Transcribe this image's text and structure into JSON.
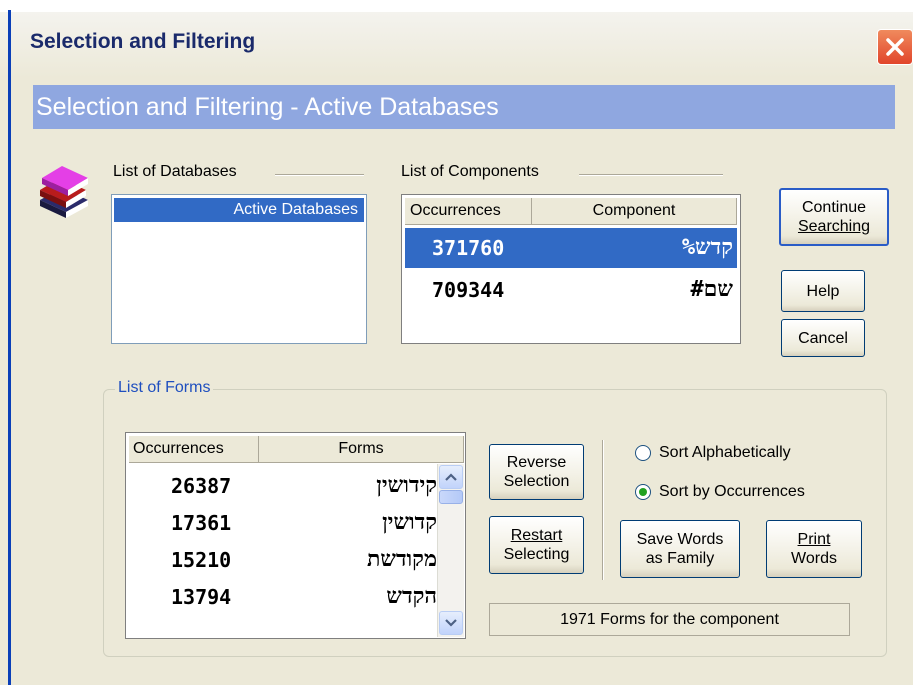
{
  "window": {
    "title": "Selection and Filtering",
    "banner": "Selection and Filtering - Active Databases"
  },
  "databases": {
    "label": "List of Databases",
    "items": [
      "Active Databases"
    ]
  },
  "components": {
    "label": "List of Components",
    "headers": [
      "Occurrences",
      "Component"
    ],
    "rows": [
      {
        "count": "371760",
        "component": "קדש%"
      },
      {
        "count": "709344",
        "component": "שם#"
      }
    ]
  },
  "buttons": {
    "continue_line1": "Continue",
    "continue_line2": "Searching",
    "help": "Help",
    "cancel": "Cancel",
    "reverse_line1": "Reverse",
    "reverse_line2": "Selection",
    "restart_line1": "Restart",
    "restart_line2": "Selecting",
    "save_line1": "Save Words",
    "save_line2": "as Family",
    "print_line1": "Print",
    "print_line2": "Words"
  },
  "forms": {
    "label": "List of Forms",
    "headers": [
      "Occurrences",
      "Forms"
    ],
    "rows": [
      {
        "count": "26387",
        "form": "קידושין"
      },
      {
        "count": "17361",
        "form": "קדושין"
      },
      {
        "count": "15210",
        "form": "מקודשת"
      },
      {
        "count": "13794",
        "form": "הקדש"
      }
    ]
  },
  "sort": {
    "alphabetically": "Sort Alphabetically",
    "by_occurrences": "Sort by Occurrences",
    "selected": "by_occurrences"
  },
  "status": "1971 Forms for the component",
  "colors": {
    "banner": "#8fa7e0",
    "selection": "#316ac5",
    "window_bg": "#ece9d8",
    "group_label": "#1f4fbf",
    "close_button": "#e1452b"
  },
  "icons": [
    "books-icon",
    "close-icon",
    "scroll-up-icon",
    "scroll-down-icon"
  ]
}
